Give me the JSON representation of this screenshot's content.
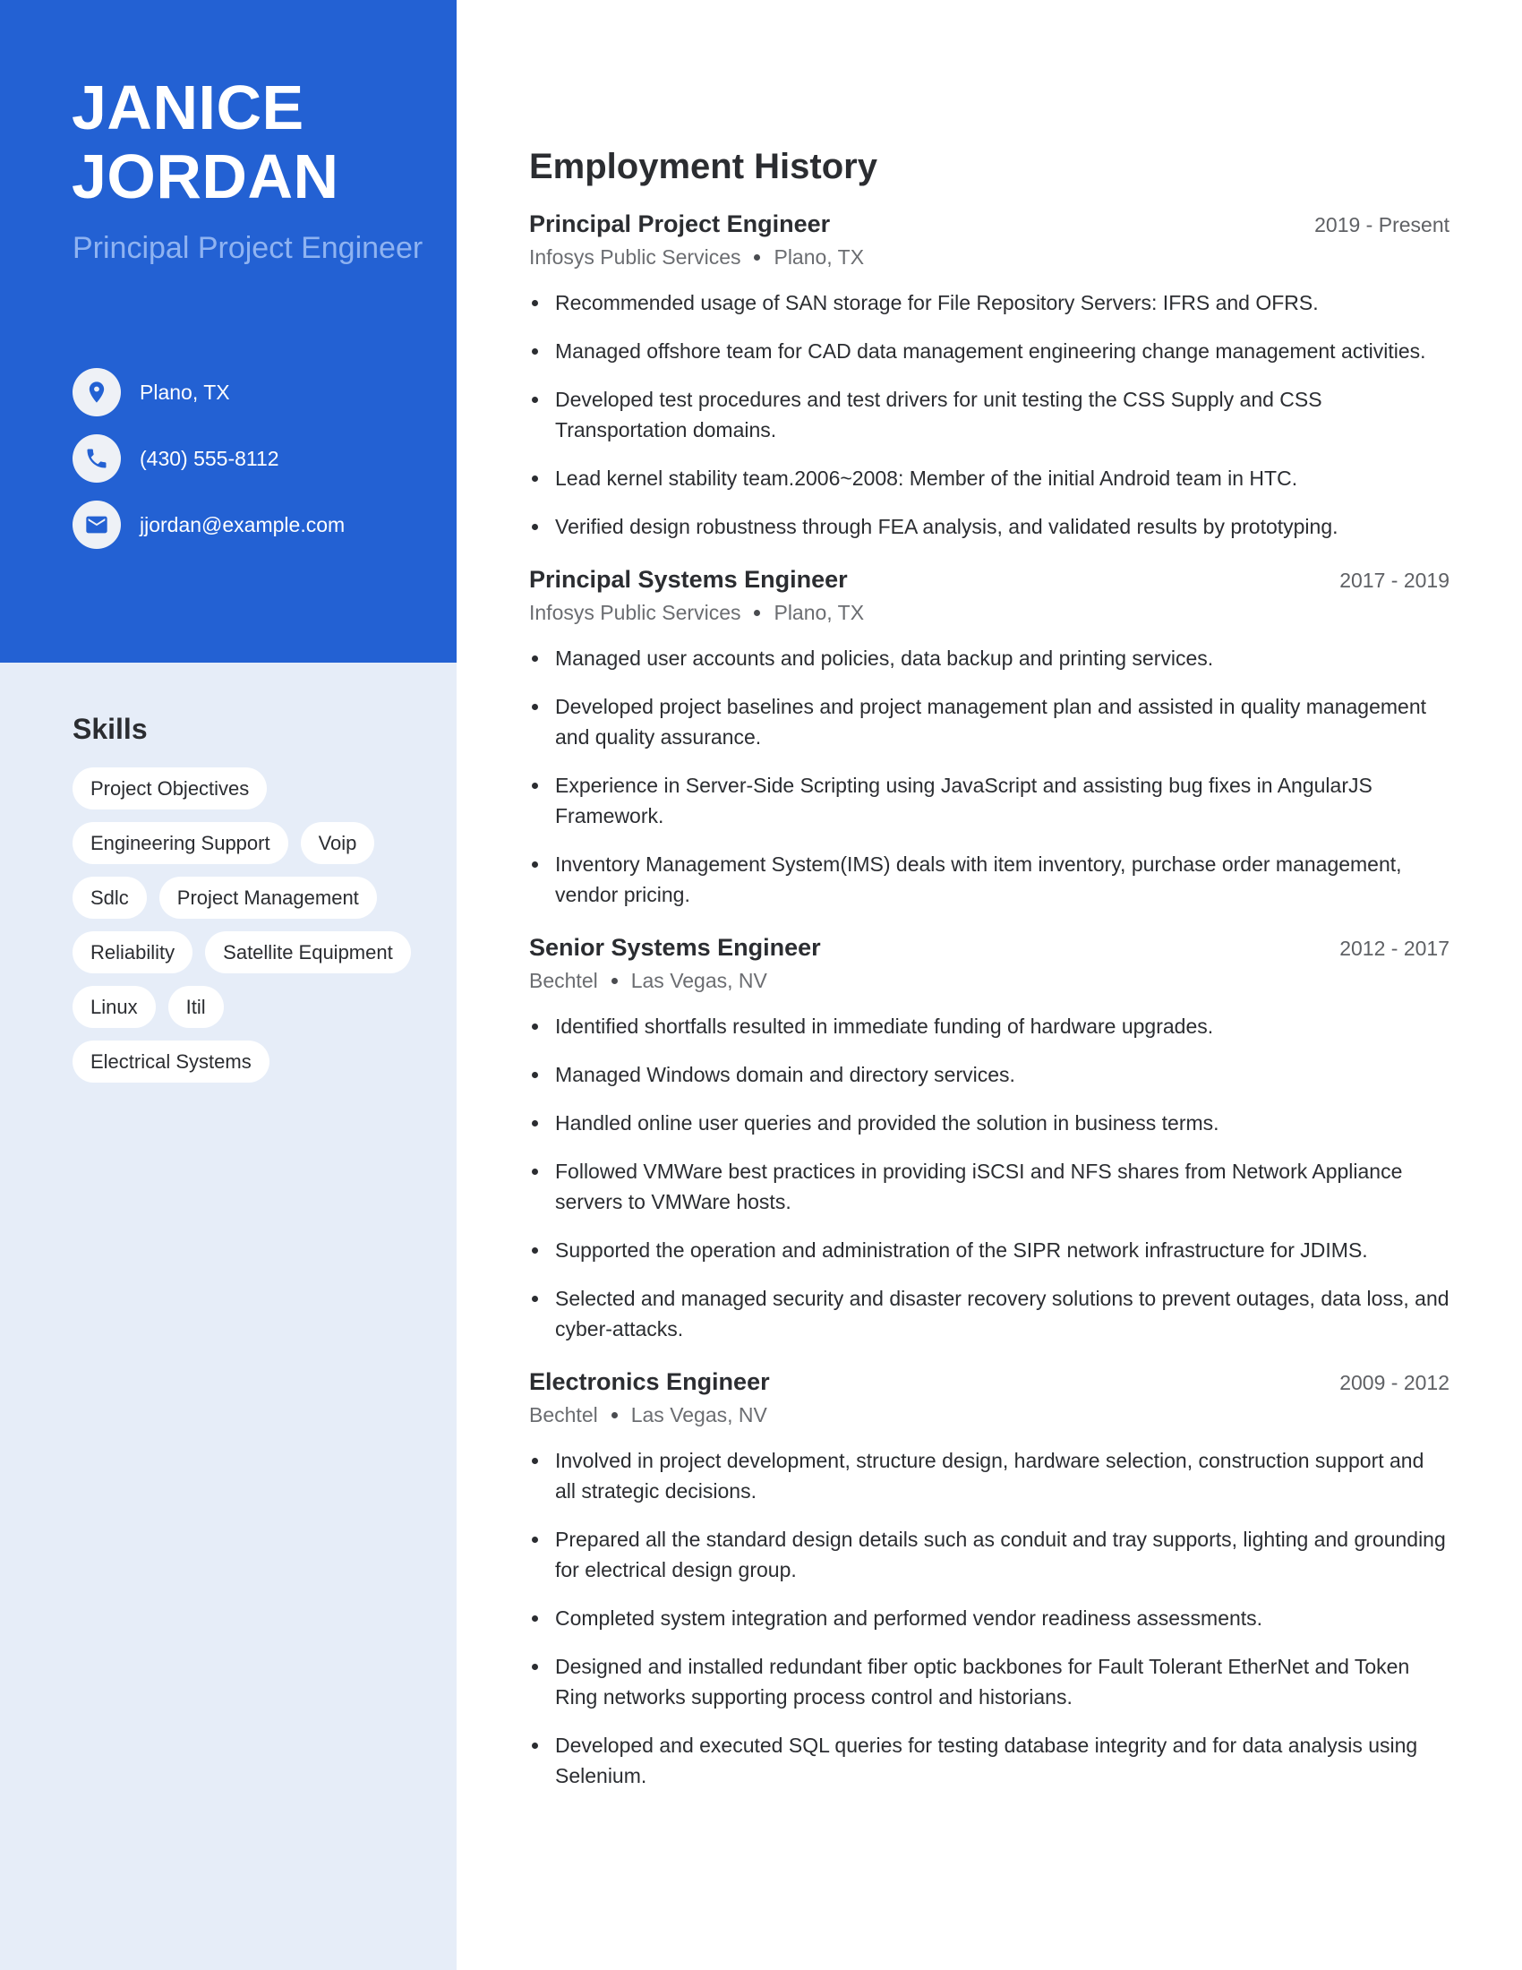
{
  "profile": {
    "first_name": "JANICE",
    "last_name": "JORDAN",
    "headline": "Principal Project Engineer"
  },
  "contacts": [
    {
      "icon": "location-pin-icon",
      "text": "Plano, TX"
    },
    {
      "icon": "phone-icon",
      "text": "(430) 555-8112"
    },
    {
      "icon": "envelope-icon",
      "text": "jjordan@example.com"
    }
  ],
  "skills": {
    "title": "Skills",
    "items": [
      "Project Objectives",
      "Engineering Support",
      "Voip",
      "Sdlc",
      "Project Management",
      "Reliability",
      "Satellite Equipment",
      "Linux",
      "Itil",
      "Electrical Systems"
    ]
  },
  "employment": {
    "title": "Employment History",
    "jobs": [
      {
        "title": "Principal Project Engineer",
        "dates": "2019 - Present",
        "company": "Infosys Public Services",
        "location": "Plano, TX",
        "bullets": [
          "Recommended usage of SAN storage for File Repository Servers: IFRS and OFRS.",
          "Managed offshore team for CAD data management engineering change management activities.",
          "Developed test procedures and test drivers for unit testing the CSS Supply and CSS Transportation domains.",
          "Lead kernel stability team.2006~2008: Member of the initial Android team in HTC.",
          "Verified design robustness through FEA analysis, and validated results by prototyping."
        ]
      },
      {
        "title": "Principal Systems Engineer",
        "dates": "2017 - 2019",
        "company": "Infosys Public Services",
        "location": "Plano, TX",
        "bullets": [
          "Managed user accounts and policies, data backup and printing services.",
          "Developed project baselines and project management plan and assisted in quality management and quality assurance.",
          "Experience in Server-Side Scripting using JavaScript and assisting bug fixes in AngularJS Framework.",
          "Inventory Management System(IMS) deals with item inventory, purchase order management, vendor pricing."
        ]
      },
      {
        "title": "Senior Systems Engineer",
        "dates": "2012 - 2017",
        "company": "Bechtel",
        "location": "Las Vegas, NV",
        "bullets": [
          "Identified shortfalls resulted in immediate funding of hardware upgrades.",
          "Managed Windows domain and directory services.",
          "Handled online user queries and provided the solution in business terms.",
          "Followed VMWare best practices in providing iSCSI and NFS shares from Network Appliance servers to VMWare hosts.",
          "Supported the operation and administration of the SIPR network infrastructure for JDIMS.",
          "Selected and managed security and disaster recovery solutions to prevent outages, data loss, and cyber-attacks."
        ]
      },
      {
        "title": "Electronics Engineer",
        "dates": "2009 - 2012",
        "company": "Bechtel",
        "location": "Las Vegas, NV",
        "bullets": [
          "Involved in project development, structure design, hardware selection, construction support and all strategic decisions.",
          "Prepared all the standard design details such as conduit and tray supports, lighting and grounding for electrical design group.",
          "Completed system integration and performed vendor readiness assessments.",
          "Designed and installed redundant fiber optic backbones for Fault Tolerant EtherNet and Token Ring networks supporting process control and historians.",
          "Developed and executed SQL queries for testing database integrity and for data analysis using Selenium."
        ]
      }
    ]
  },
  "colors": {
    "accent": "#2361d3",
    "sidebar_bg": "#e6edf8",
    "headline": "#8fb3f1",
    "text": "#2b2d31",
    "muted": "#6b6d71"
  }
}
